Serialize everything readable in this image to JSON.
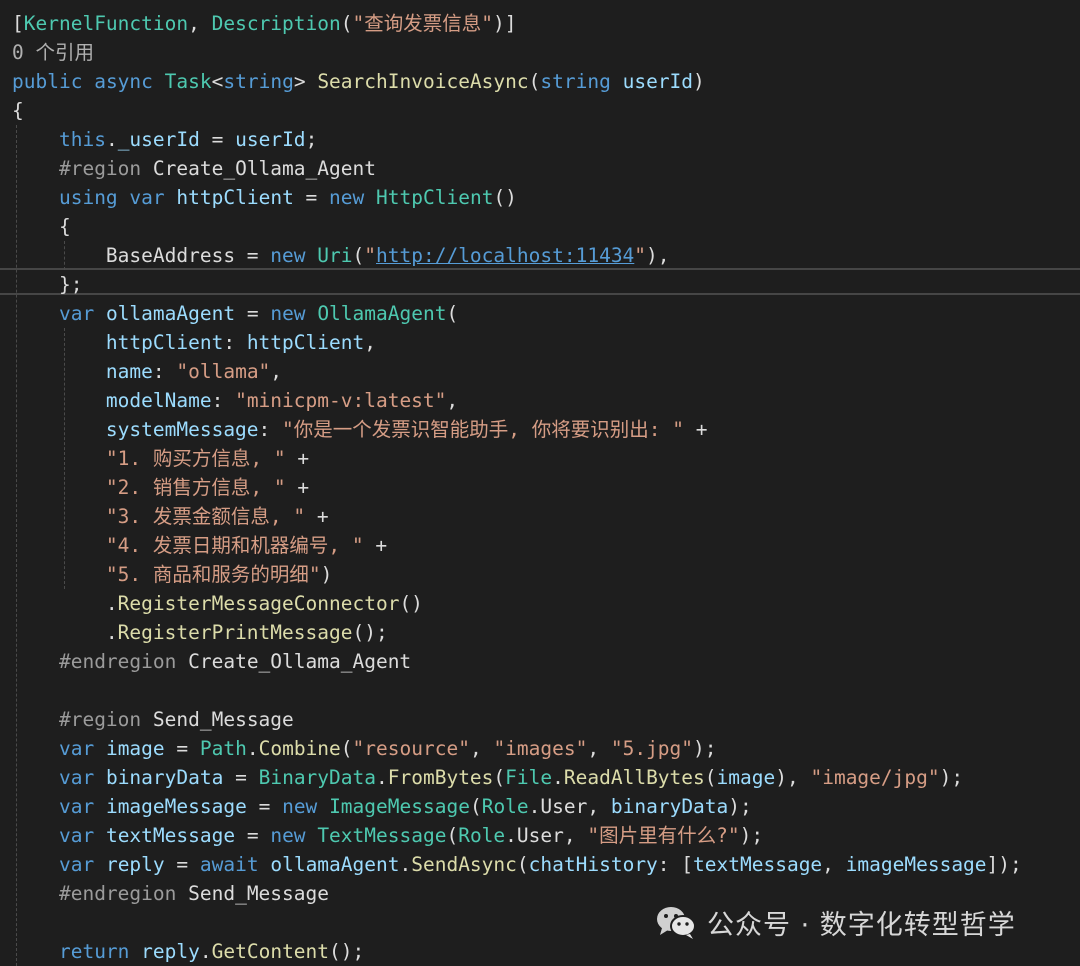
{
  "editor": {
    "lines": [
      {
        "tokens": [
          [
            "pl",
            "["
          ],
          [
            "ty",
            "KernelFunction"
          ],
          [
            "pl",
            ", "
          ],
          [
            "ty",
            "Description"
          ],
          [
            "pl",
            "("
          ],
          [
            "st",
            "\"查询发票信息\""
          ],
          [
            "pl",
            ")]"
          ]
        ]
      },
      {
        "tokens": [
          [
            "ann",
            "0 个引用"
          ]
        ]
      },
      {
        "tokens": [
          [
            "kw",
            "public"
          ],
          [
            "pl",
            " "
          ],
          [
            "kw",
            "async"
          ],
          [
            "pl",
            " "
          ],
          [
            "ty",
            "Task"
          ],
          [
            "pl",
            "<"
          ],
          [
            "kw",
            "string"
          ],
          [
            "pl",
            "> "
          ],
          [
            "fn",
            "SearchInvoiceAsync"
          ],
          [
            "pl",
            "("
          ],
          [
            "kw",
            "string"
          ],
          [
            "pl",
            " "
          ],
          [
            "va",
            "userId"
          ],
          [
            "pl",
            ")"
          ]
        ]
      },
      {
        "tokens": [
          [
            "pl",
            "{"
          ]
        ]
      },
      {
        "tokens": [
          [
            "pl",
            "    "
          ],
          [
            "kw",
            "this"
          ],
          [
            "pl",
            "."
          ],
          [
            "va",
            "_userId"
          ],
          [
            "pl",
            " = "
          ],
          [
            "va",
            "userId"
          ],
          [
            "pl",
            ";"
          ]
        ]
      },
      {
        "tokens": [
          [
            "pl",
            "    "
          ],
          [
            "pr",
            "#region"
          ],
          [
            "pl",
            " Create_Ollama_Agent"
          ]
        ]
      },
      {
        "tokens": [
          [
            "pl",
            "    "
          ],
          [
            "kw",
            "using"
          ],
          [
            "pl",
            " "
          ],
          [
            "kw",
            "var"
          ],
          [
            "pl",
            " "
          ],
          [
            "va",
            "httpClient"
          ],
          [
            "pl",
            " = "
          ],
          [
            "kw",
            "new"
          ],
          [
            "pl",
            " "
          ],
          [
            "ty",
            "HttpClient"
          ],
          [
            "pl",
            "()"
          ]
        ]
      },
      {
        "tokens": [
          [
            "pl",
            "    {"
          ]
        ]
      },
      {
        "tokens": [
          [
            "pl",
            "        "
          ],
          [
            "cl",
            "BaseAddress"
          ],
          [
            "pl",
            " = "
          ],
          [
            "kw",
            "new"
          ],
          [
            "pl",
            " "
          ],
          [
            "ty",
            "Uri"
          ],
          [
            "pl",
            "("
          ],
          [
            "st",
            "\""
          ],
          [
            "lk",
            "http://localhost:11434"
          ],
          [
            "st",
            "\""
          ],
          [
            "pl",
            "),"
          ]
        ]
      },
      {
        "tokens": [
          [
            "pl",
            "    };"
          ]
        ]
      },
      {
        "tokens": [
          [
            "pl",
            "    "
          ],
          [
            "kw",
            "var"
          ],
          [
            "pl",
            " "
          ],
          [
            "va",
            "ollamaAgent"
          ],
          [
            "pl",
            " = "
          ],
          [
            "kw",
            "new"
          ],
          [
            "pl",
            " "
          ],
          [
            "ty",
            "OllamaAgent"
          ],
          [
            "pl",
            "("
          ]
        ]
      },
      {
        "tokens": [
          [
            "pl",
            "        "
          ],
          [
            "va",
            "httpClient"
          ],
          [
            "pl",
            ": "
          ],
          [
            "va",
            "httpClient"
          ],
          [
            "pl",
            ","
          ]
        ]
      },
      {
        "tokens": [
          [
            "pl",
            "        "
          ],
          [
            "va",
            "name"
          ],
          [
            "pl",
            ": "
          ],
          [
            "st",
            "\"ollama\""
          ],
          [
            "pl",
            ","
          ]
        ]
      },
      {
        "tokens": [
          [
            "pl",
            "        "
          ],
          [
            "va",
            "modelName"
          ],
          [
            "pl",
            ": "
          ],
          [
            "st",
            "\"minicpm-v:latest\""
          ],
          [
            "pl",
            ","
          ]
        ]
      },
      {
        "tokens": [
          [
            "pl",
            "        "
          ],
          [
            "va",
            "systemMessage"
          ],
          [
            "pl",
            ": "
          ],
          [
            "st",
            "\"你是一个发票识智能助手, 你将要识别出: \""
          ],
          [
            "pl",
            " +"
          ]
        ]
      },
      {
        "tokens": [
          [
            "pl",
            "        "
          ],
          [
            "st",
            "\"1. 购买方信息, \""
          ],
          [
            "pl",
            " +"
          ]
        ]
      },
      {
        "tokens": [
          [
            "pl",
            "        "
          ],
          [
            "st",
            "\"2. 销售方信息, \""
          ],
          [
            "pl",
            " +"
          ]
        ]
      },
      {
        "tokens": [
          [
            "pl",
            "        "
          ],
          [
            "st",
            "\"3. 发票金额信息, \""
          ],
          [
            "pl",
            " +"
          ]
        ]
      },
      {
        "tokens": [
          [
            "pl",
            "        "
          ],
          [
            "st",
            "\"4. 发票日期和机器编号, \""
          ],
          [
            "pl",
            " +"
          ]
        ]
      },
      {
        "tokens": [
          [
            "pl",
            "        "
          ],
          [
            "st",
            "\"5. 商品和服务的明细\""
          ],
          [
            "pl",
            ")"
          ]
        ]
      },
      {
        "tokens": [
          [
            "pl",
            "        ."
          ],
          [
            "fn",
            "RegisterMessageConnector"
          ],
          [
            "pl",
            "()"
          ]
        ]
      },
      {
        "tokens": [
          [
            "pl",
            "        ."
          ],
          [
            "fn",
            "RegisterPrintMessage"
          ],
          [
            "pl",
            "();"
          ]
        ]
      },
      {
        "tokens": [
          [
            "pl",
            "    "
          ],
          [
            "pr",
            "#endregion"
          ],
          [
            "pl",
            " Create_Ollama_Agent"
          ]
        ]
      },
      {
        "tokens": []
      },
      {
        "tokens": [
          [
            "pl",
            "    "
          ],
          [
            "pr",
            "#region"
          ],
          [
            "pl",
            " Send_Message"
          ]
        ]
      },
      {
        "tokens": [
          [
            "pl",
            "    "
          ],
          [
            "kw",
            "var"
          ],
          [
            "pl",
            " "
          ],
          [
            "va",
            "image"
          ],
          [
            "pl",
            " = "
          ],
          [
            "ty",
            "Path"
          ],
          [
            "pl",
            "."
          ],
          [
            "fn",
            "Combine"
          ],
          [
            "pl",
            "("
          ],
          [
            "st",
            "\"resource\""
          ],
          [
            "pl",
            ", "
          ],
          [
            "st",
            "\"images\""
          ],
          [
            "pl",
            ", "
          ],
          [
            "st",
            "\"5.jpg\""
          ],
          [
            "pl",
            ");"
          ]
        ]
      },
      {
        "tokens": [
          [
            "pl",
            "    "
          ],
          [
            "kw",
            "var"
          ],
          [
            "pl",
            " "
          ],
          [
            "va",
            "binaryData"
          ],
          [
            "pl",
            " = "
          ],
          [
            "ty",
            "BinaryData"
          ],
          [
            "pl",
            "."
          ],
          [
            "fn",
            "FromBytes"
          ],
          [
            "pl",
            "("
          ],
          [
            "ty",
            "File"
          ],
          [
            "pl",
            "."
          ],
          [
            "fn",
            "ReadAllBytes"
          ],
          [
            "pl",
            "("
          ],
          [
            "va",
            "image"
          ],
          [
            "pl",
            "), "
          ],
          [
            "st",
            "\"image/jpg\""
          ],
          [
            "pl",
            ");"
          ]
        ]
      },
      {
        "tokens": [
          [
            "pl",
            "    "
          ],
          [
            "kw",
            "var"
          ],
          [
            "pl",
            " "
          ],
          [
            "va",
            "imageMessage"
          ],
          [
            "pl",
            " = "
          ],
          [
            "kw",
            "new"
          ],
          [
            "pl",
            " "
          ],
          [
            "ty",
            "ImageMessage"
          ],
          [
            "pl",
            "("
          ],
          [
            "ty",
            "Role"
          ],
          [
            "pl",
            "."
          ],
          [
            "cl",
            "User"
          ],
          [
            "pl",
            ", "
          ],
          [
            "va",
            "binaryData"
          ],
          [
            "pl",
            ");"
          ]
        ]
      },
      {
        "tokens": [
          [
            "pl",
            "    "
          ],
          [
            "kw",
            "var"
          ],
          [
            "pl",
            " "
          ],
          [
            "va",
            "textMessage"
          ],
          [
            "pl",
            " = "
          ],
          [
            "kw",
            "new"
          ],
          [
            "pl",
            " "
          ],
          [
            "ty",
            "TextMessage"
          ],
          [
            "pl",
            "("
          ],
          [
            "ty",
            "Role"
          ],
          [
            "pl",
            "."
          ],
          [
            "cl",
            "User"
          ],
          [
            "pl",
            ", "
          ],
          [
            "st",
            "\"图片里有什么?\""
          ],
          [
            "pl",
            ");"
          ]
        ]
      },
      {
        "tokens": [
          [
            "pl",
            "    "
          ],
          [
            "kw",
            "var"
          ],
          [
            "pl",
            " "
          ],
          [
            "va",
            "reply"
          ],
          [
            "pl",
            " = "
          ],
          [
            "kw",
            "await"
          ],
          [
            "pl",
            " "
          ],
          [
            "va",
            "ollamaAgent"
          ],
          [
            "pl",
            "."
          ],
          [
            "fn",
            "SendAsync"
          ],
          [
            "pl",
            "("
          ],
          [
            "va",
            "chatHistory"
          ],
          [
            "pl",
            ": ["
          ],
          [
            "va",
            "textMessage"
          ],
          [
            "pl",
            ", "
          ],
          [
            "va",
            "imageMessage"
          ],
          [
            "pl",
            "]);"
          ]
        ]
      },
      {
        "tokens": [
          [
            "pl",
            "    "
          ],
          [
            "pr",
            "#endregion"
          ],
          [
            "pl",
            " Send_Message"
          ]
        ]
      },
      {
        "tokens": []
      },
      {
        "tokens": [
          [
            "pl",
            "    "
          ],
          [
            "kw",
            "return"
          ],
          [
            "pl",
            " "
          ],
          [
            "va",
            "reply"
          ],
          [
            "pl",
            "."
          ],
          [
            "fn",
            "GetContent"
          ],
          [
            "pl",
            "();"
          ]
        ]
      }
    ]
  },
  "watermark": {
    "text": "公众号 · 数字化转型哲学",
    "icon": "wechat-icon"
  },
  "colors": {
    "background": "#1e1e1e",
    "keyword": "#569cd6",
    "type": "#4ec9b0",
    "method": "#dcdcaa",
    "string": "#d69d85",
    "variable": "#9cdcfe",
    "preprocessor": "#9b9b9b"
  }
}
